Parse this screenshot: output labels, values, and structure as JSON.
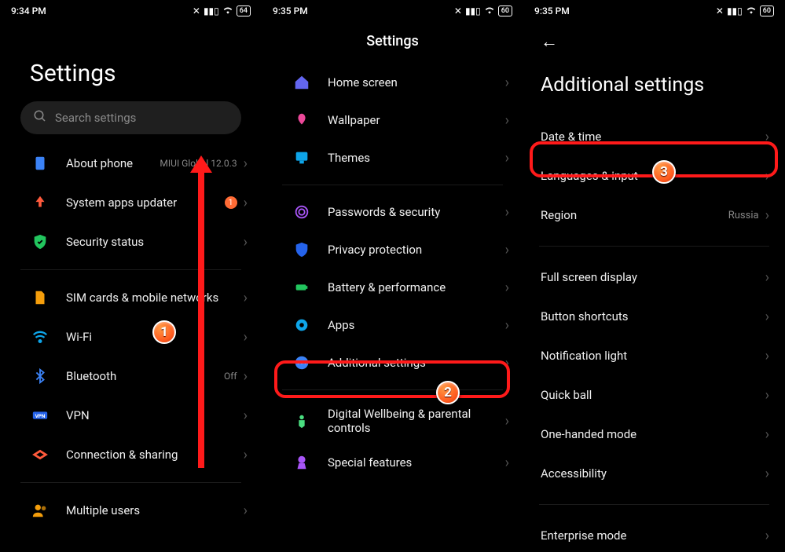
{
  "screen1": {
    "status": {
      "time": "9:34 PM",
      "battery": "64"
    },
    "title": "Settings",
    "search_placeholder": "Search settings",
    "items": [
      {
        "label": "About phone",
        "extra": "MIUI Global 12.0.3"
      },
      {
        "label": "System apps updater",
        "badge": "1"
      },
      {
        "label": "Security status"
      },
      {
        "label": "SIM cards & mobile networks"
      },
      {
        "label": "Wi-Fi"
      },
      {
        "label": "Bluetooth",
        "extra": "Off"
      },
      {
        "label": "VPN"
      },
      {
        "label": "Connection & sharing"
      },
      {
        "label": "Multiple users"
      }
    ]
  },
  "screen2": {
    "status": {
      "time": "9:35 PM",
      "battery": "60"
    },
    "title": "Settings",
    "items": [
      {
        "label": "Home screen"
      },
      {
        "label": "Wallpaper"
      },
      {
        "label": "Themes"
      },
      {
        "label": "Passwords & security"
      },
      {
        "label": "Privacy protection"
      },
      {
        "label": "Battery & performance"
      },
      {
        "label": "Apps"
      },
      {
        "label": "Additional settings"
      },
      {
        "label": "Digital Wellbeing & parental controls"
      },
      {
        "label": "Special features"
      }
    ]
  },
  "screen3": {
    "status": {
      "time": "9:35 PM",
      "battery": "60"
    },
    "title": "Additional settings",
    "items": [
      {
        "label": "Date & time"
      },
      {
        "label": "Languages & input"
      },
      {
        "label": "Region",
        "extra": "Russia"
      },
      {
        "label": "Full screen display"
      },
      {
        "label": "Button shortcuts"
      },
      {
        "label": "Notification light"
      },
      {
        "label": "Quick ball"
      },
      {
        "label": "One-handed mode"
      },
      {
        "label": "Accessibility"
      },
      {
        "label": "Enterprise mode"
      }
    ]
  },
  "annotations": {
    "callouts": [
      "1",
      "2",
      "3"
    ],
    "highlight_color": "#ff1a1a"
  }
}
